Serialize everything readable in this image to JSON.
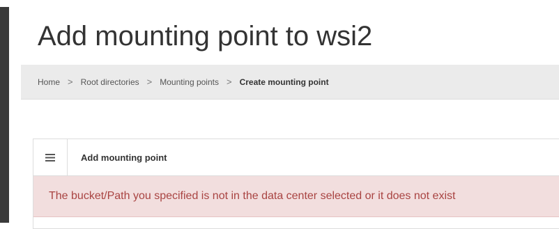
{
  "page": {
    "title": "Add mounting point to wsi2"
  },
  "breadcrumb": {
    "items": [
      "Home",
      "Root directories",
      "Mounting points"
    ],
    "current": "Create mounting point",
    "separator": ">"
  },
  "panel": {
    "menu_icon": "hamburger-menu-icon",
    "title": "Add mounting point"
  },
  "alert": {
    "message": "The bucket/Path you specified is not in the data center selected or it does not exist",
    "color": "#a94442",
    "background": "#f2dede"
  }
}
